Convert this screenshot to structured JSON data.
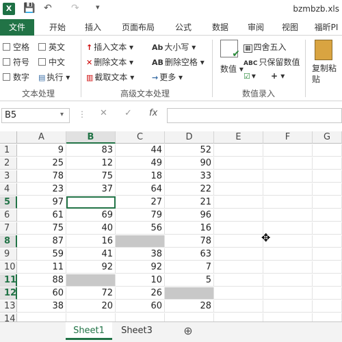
{
  "titlebar": {
    "title": "bzmbzb.xls",
    "undo": "↶",
    "redo": "↷"
  },
  "tabs": [
    "文件",
    "开始",
    "插入",
    "页面布局",
    "公式",
    "数据",
    "审阅",
    "视图",
    "福昕PI"
  ],
  "ribbon": {
    "text_processing": {
      "label": "文本处理",
      "checks": [
        "空格",
        "英文",
        "符号",
        "中文",
        "数字"
      ],
      "exec": "执行"
    },
    "advanced_text": {
      "label": "高级文本处理",
      "insert": "插入文本",
      "delete": "删除文本",
      "extract": "截取文本",
      "case": "大小写",
      "del_space": "删除空格",
      "more": "更多"
    },
    "numeric": {
      "label": "数值录入",
      "value": "数值",
      "round": "四舍五入",
      "keep_value": "只保留数值"
    },
    "paste": "复制粘贴"
  },
  "formula_bar": {
    "name_box": "B5",
    "fx": "fx"
  },
  "columns": [
    "A",
    "B",
    "C",
    "D",
    "E",
    "F",
    "G"
  ],
  "rows": [
    {
      "n": "1",
      "a": "9",
      "b": "83",
      "c": "44",
      "d": "52"
    },
    {
      "n": "2",
      "a": "25",
      "b": "12",
      "c": "49",
      "d": "90"
    },
    {
      "n": "3",
      "a": "78",
      "b": "75",
      "c": "18",
      "d": "33"
    },
    {
      "n": "4",
      "a": "23",
      "b": "37",
      "c": "64",
      "d": "22"
    },
    {
      "n": "5",
      "a": "97",
      "b": "",
      "c": "27",
      "d": "21"
    },
    {
      "n": "6",
      "a": "61",
      "b": "69",
      "c": "79",
      "d": "96"
    },
    {
      "n": "7",
      "a": "75",
      "b": "40",
      "c": "56",
      "d": "16"
    },
    {
      "n": "8",
      "a": "87",
      "b": "16",
      "c": "",
      "d": "78"
    },
    {
      "n": "9",
      "a": "59",
      "b": "41",
      "c": "38",
      "d": "63"
    },
    {
      "n": "10",
      "a": "11",
      "b": "92",
      "c": "92",
      "d": "7"
    },
    {
      "n": "11",
      "a": "88",
      "b": "",
      "c": "10",
      "d": "5"
    },
    {
      "n": "12",
      "a": "60",
      "b": "72",
      "c": "26",
      "d": ""
    },
    {
      "n": "13",
      "a": "38",
      "b": "20",
      "c": "60",
      "d": "28"
    },
    {
      "n": "14",
      "a": "",
      "b": "",
      "c": "",
      "d": ""
    }
  ],
  "sheets": [
    "Sheet1",
    "Sheet3"
  ],
  "add_sheet": "⊕"
}
